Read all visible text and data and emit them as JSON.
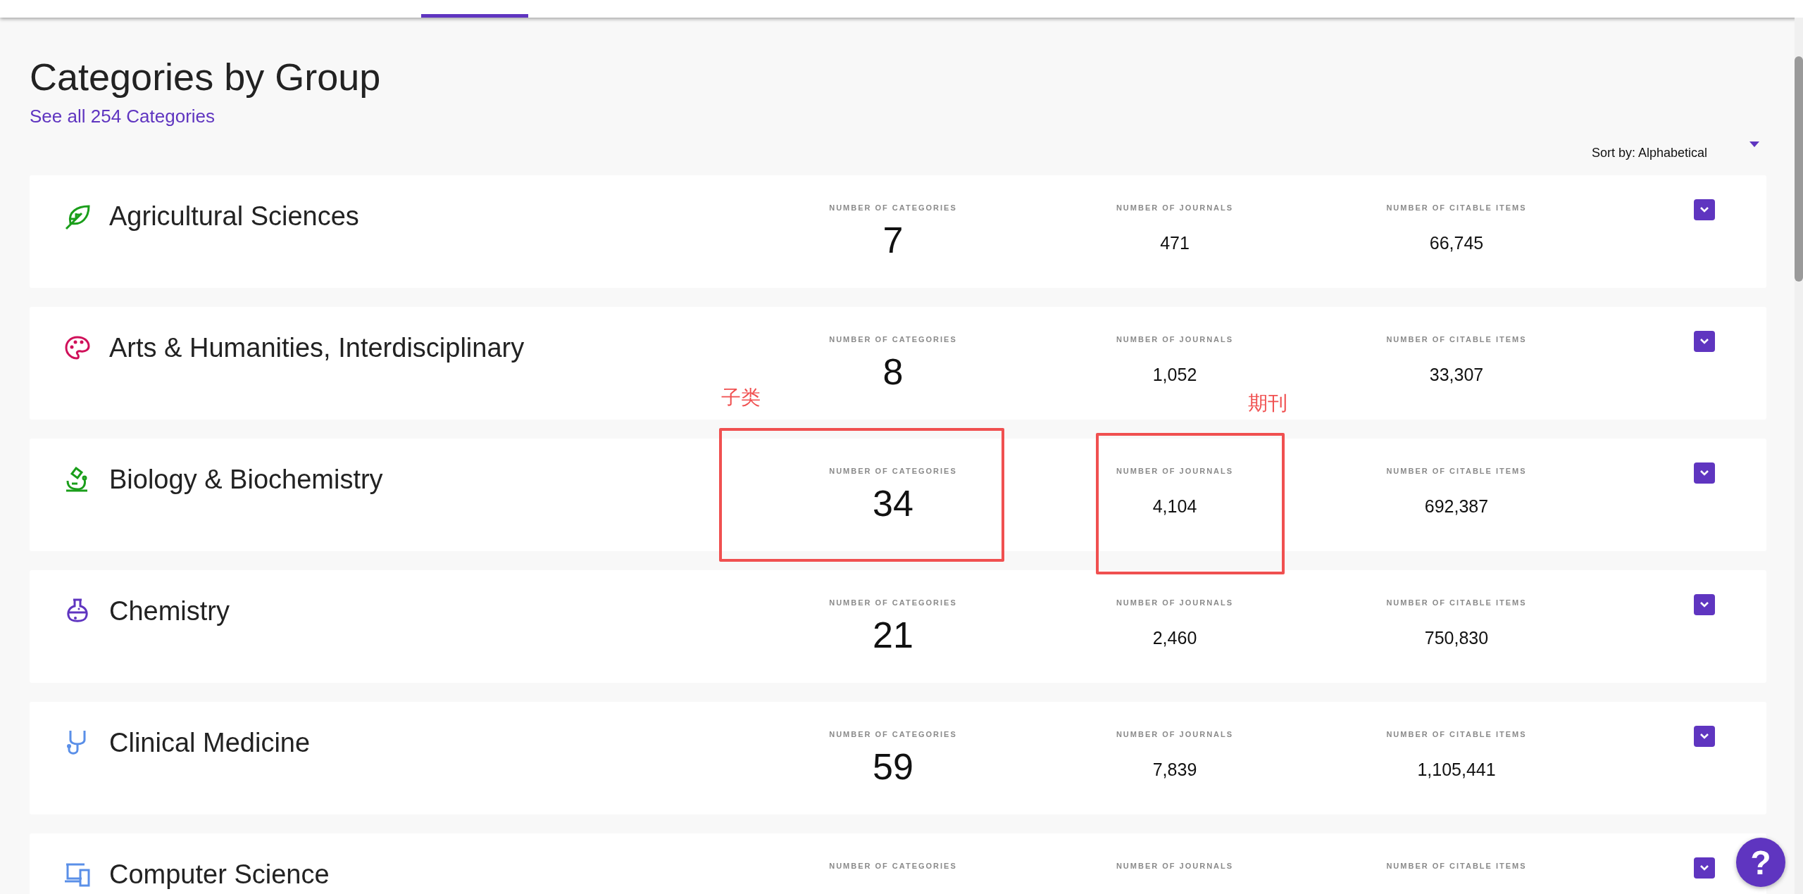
{
  "page_title": "Categories by Group",
  "see_all_link": "See all 254 Categories",
  "sort": {
    "label": "Sort by: Alphabetical"
  },
  "groups": [
    {
      "name": "Agricultural Sciences",
      "kind": "leaf",
      "color": "#1a9e1a",
      "categories_label": "NUMBER OF CATEGORIES",
      "categories": "7",
      "journals_label": "NUMBER OF JOURNALS",
      "journals": "471",
      "citable_label": "NUMBER OF CITABLE ITEMS",
      "citable": "66,745"
    },
    {
      "name": "Arts & Humanities, Interdisciplinary",
      "kind": "palette",
      "color": "#d0105a",
      "categories_label": "NUMBER OF CATEGORIES",
      "categories": "8",
      "journals_label": "NUMBER OF JOURNALS",
      "journals": "1,052",
      "citable_label": "NUMBER OF CITABLE ITEMS",
      "citable": "33,307"
    },
    {
      "name": "Biology & Biochemistry",
      "kind": "microscope",
      "color": "#1a9e1a",
      "categories_label": "NUMBER OF CATEGORIES",
      "categories": "34",
      "journals_label": "NUMBER OF JOURNALS",
      "journals": "4,104",
      "citable_label": "NUMBER OF CITABLE ITEMS",
      "citable": "692,387"
    },
    {
      "name": "Chemistry",
      "kind": "flask",
      "color": "#5f35c0",
      "categories_label": "NUMBER OF CATEGORIES",
      "categories": "21",
      "journals_label": "NUMBER OF JOURNALS",
      "journals": "2,460",
      "citable_label": "NUMBER OF CITABLE ITEMS",
      "citable": "750,830"
    },
    {
      "name": "Clinical Medicine",
      "kind": "stethoscope",
      "color": "#5a8fe8",
      "categories_label": "NUMBER OF CATEGORIES",
      "categories": "59",
      "journals_label": "NUMBER OF JOURNALS",
      "journals": "7,839",
      "citable_label": "NUMBER OF CITABLE ITEMS",
      "citable": "1,105,441"
    },
    {
      "name": "Computer Science",
      "kind": "computer",
      "color": "#5a8fe8",
      "categories_label": "NUMBER OF CATEGORIES",
      "journals_label": "NUMBER OF JOURNALS",
      "citable_label": "NUMBER OF CITABLE ITEMS"
    }
  ],
  "annotations": [
    {
      "label": "子类"
    },
    {
      "label": "期刊"
    }
  ],
  "help_button": "?"
}
